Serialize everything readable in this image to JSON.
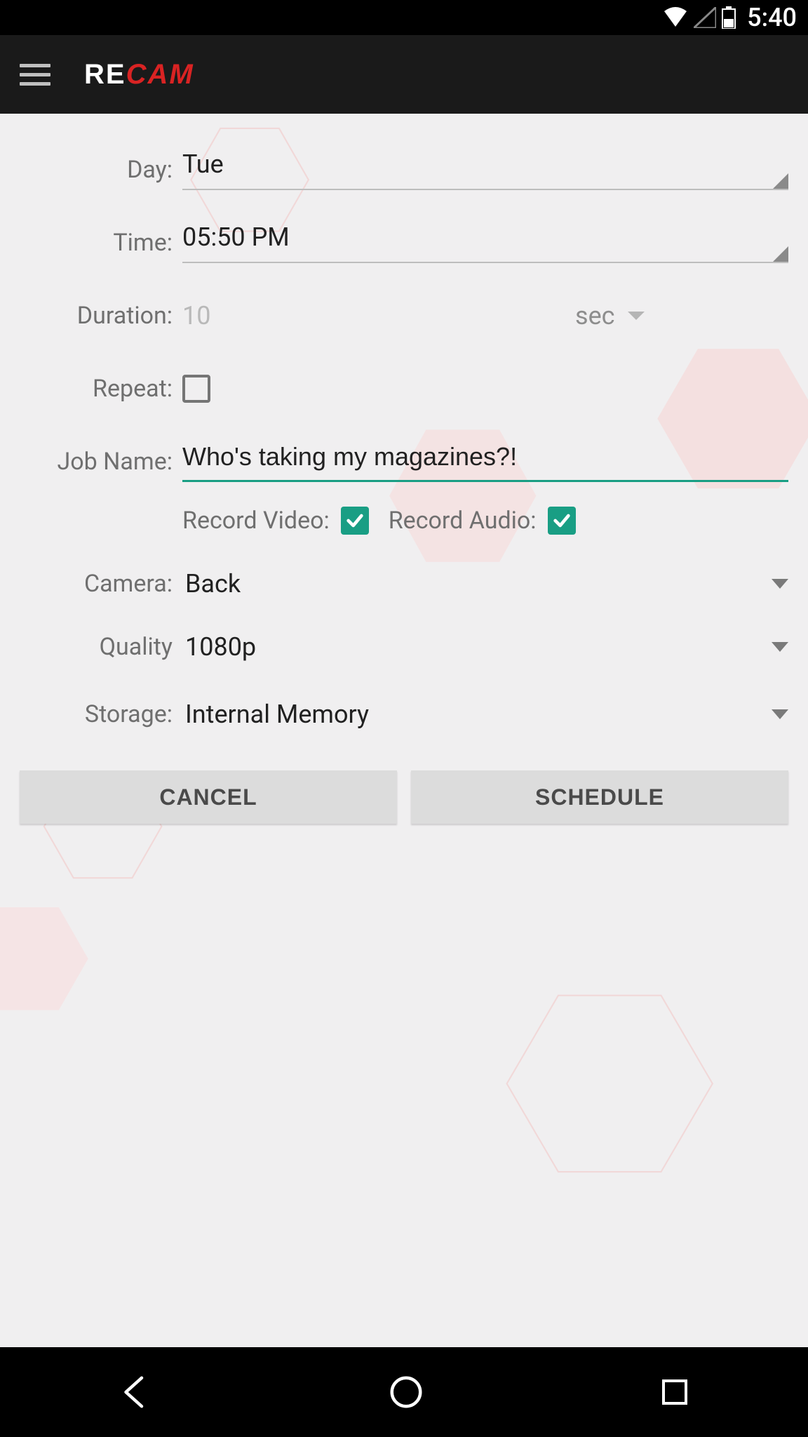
{
  "status": {
    "time": "5:40"
  },
  "logo": {
    "part1": "RE",
    "part2": "CAM"
  },
  "form": {
    "day_label": "Day:",
    "day_value": "Tue",
    "time_label": "Time:",
    "time_value": "05:50 PM",
    "duration_label": "Duration:",
    "duration_value": "10",
    "duration_unit": "sec",
    "repeat_label": "Repeat:",
    "repeat_checked": false,
    "jobname_label": "Job Name:",
    "jobname_value": "Who's taking my magazines?!",
    "record_video_label": "Record Video:",
    "record_video_checked": true,
    "record_audio_label": "Record Audio:",
    "record_audio_checked": true,
    "camera_label": "Camera:",
    "camera_value": "Back",
    "quality_label": "Quality",
    "quality_value": "1080p",
    "storage_label": "Storage:",
    "storage_value": "Internal Memory"
  },
  "buttons": {
    "cancel": "CANCEL",
    "schedule": "SCHEDULE"
  },
  "colors": {
    "accent": "#199e84",
    "brand_red": "#d92323",
    "appbar": "#1a1a1a",
    "bg": "#f0eff0"
  }
}
